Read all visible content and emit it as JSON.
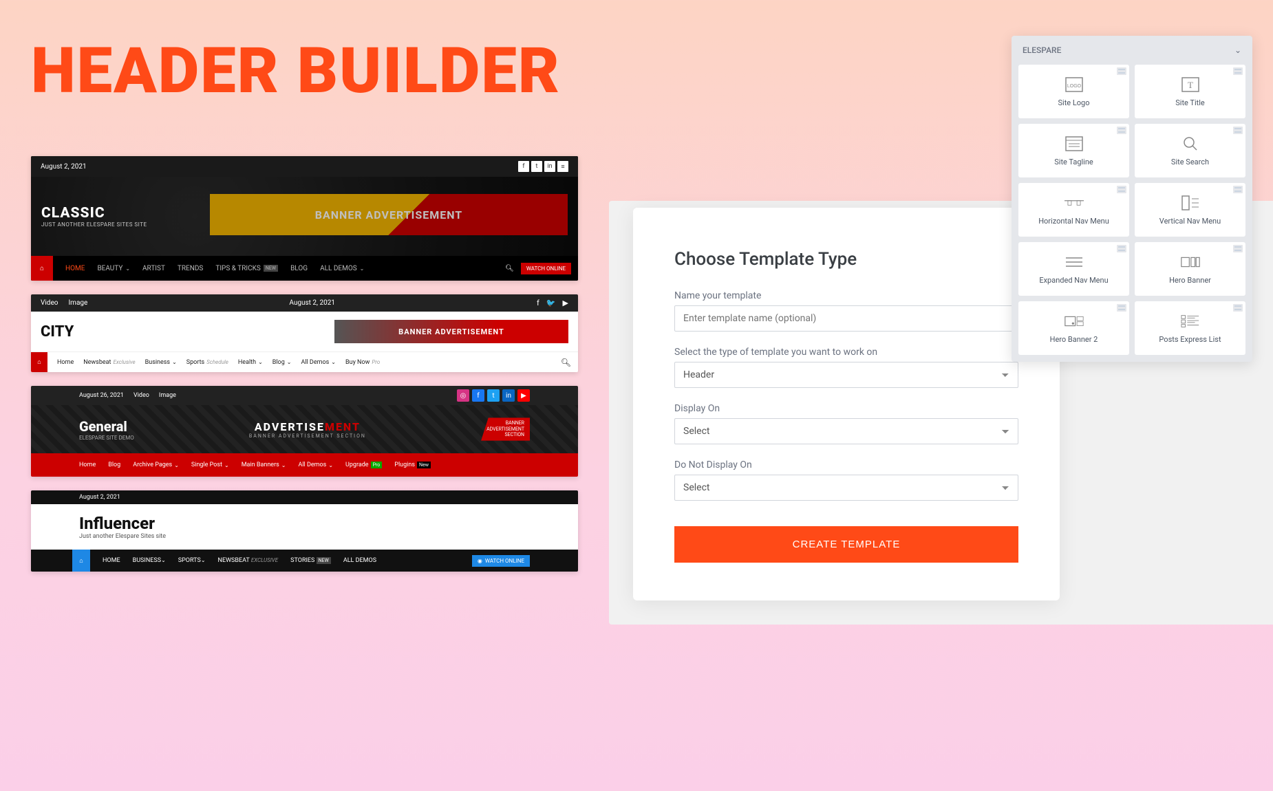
{
  "pageTitle": "HEADER BUILDER",
  "classic": {
    "date": "August 2, 2021",
    "title": "CLASSIC",
    "subtitle": "JUST ANOTHER ELESPARE SITES SITE",
    "bannerText": "BANNER ADVERTISEMENT",
    "nav": {
      "home": "HOME",
      "beauty": "BEAUTY",
      "artist": "ARTIST",
      "trends": "TRENDS",
      "tips": "TIPS & TRICKS",
      "newBadge": "NEW",
      "blog": "BLOG",
      "demos": "ALL DEMOS",
      "watch": "WATCH ONLINE"
    }
  },
  "city": {
    "topLeft1": "Video",
    "topLeft2": "Image",
    "date": "August 2, 2021",
    "title": "CITY",
    "bannerText": "BANNER ADVERTISEMENT",
    "nav": {
      "home": "Home",
      "newsbeat": "Newsbeat",
      "exclusive": "Exclusive",
      "business": "Business",
      "sports": "Sports",
      "schedule": "Schedule",
      "health": "Health",
      "blog": "Blog",
      "demos": "All Demos",
      "buy": "Buy Now",
      "pro": "Pro"
    }
  },
  "general": {
    "date": "August 26, 2021",
    "topLeft1": "Video",
    "topLeft2": "Image",
    "title": "General",
    "subtitle": "ELESPARE SITE DEMO",
    "adTitle1": "ADVERTISE",
    "adTitle2": "MENT",
    "adSub": "BANNER ADVERTISEMENT SECTION",
    "adBadge1": "BANNER",
    "adBadge2": "ADVERTISEMENT",
    "adBadge3": "SECTION",
    "nav": {
      "home": "Home",
      "blog": "Blog",
      "archive": "Archive Pages",
      "single": "Single Post",
      "banners": "Main Banners",
      "demos": "All Demos",
      "upgrade": "Upgrade",
      "proBadge": "Pro",
      "plugins": "Plugins",
      "newBadge": "New"
    }
  },
  "influencer": {
    "date": "August 2, 2021",
    "title": "Influencer",
    "subtitle": "Just another Elespare Sites site",
    "nav": {
      "home": "HOME",
      "business": "BUSINESS",
      "sports": "SPORTS",
      "newsbeat": "NEWSBEAT",
      "exclusive": "EXCLUSIVE",
      "stories": "STORIES",
      "newBadge": "NEW",
      "demos": "ALL DEMOS",
      "watch": "WATCH ONLINE"
    }
  },
  "form": {
    "title": "Choose Template Type",
    "nameLabel": "Name your template",
    "namePlaceholder": "Enter template name (optional)",
    "typeLabel": "Select the type of template you want to work on",
    "typeValue": "Header",
    "displayLabel": "Display On",
    "displayValue": "Select",
    "noDisplayLabel": "Do Not Display On",
    "noDisplayValue": "Select",
    "submit": "CREATE TEMPLATE"
  },
  "widgets": {
    "header": "ELESPARE",
    "items": {
      "siteLogo": "Site Logo",
      "siteTitle": "Site Title",
      "siteTagline": "Site Tagline",
      "siteSearch": "Site Search",
      "hNav": "Horizontal Nav Menu",
      "vNav": "Vertical Nav Menu",
      "expNav": "Expanded Nav Menu",
      "heroBanner": "Hero Banner",
      "heroBanner2": "Hero Banner 2",
      "postsExpress": "Posts Express List"
    }
  }
}
